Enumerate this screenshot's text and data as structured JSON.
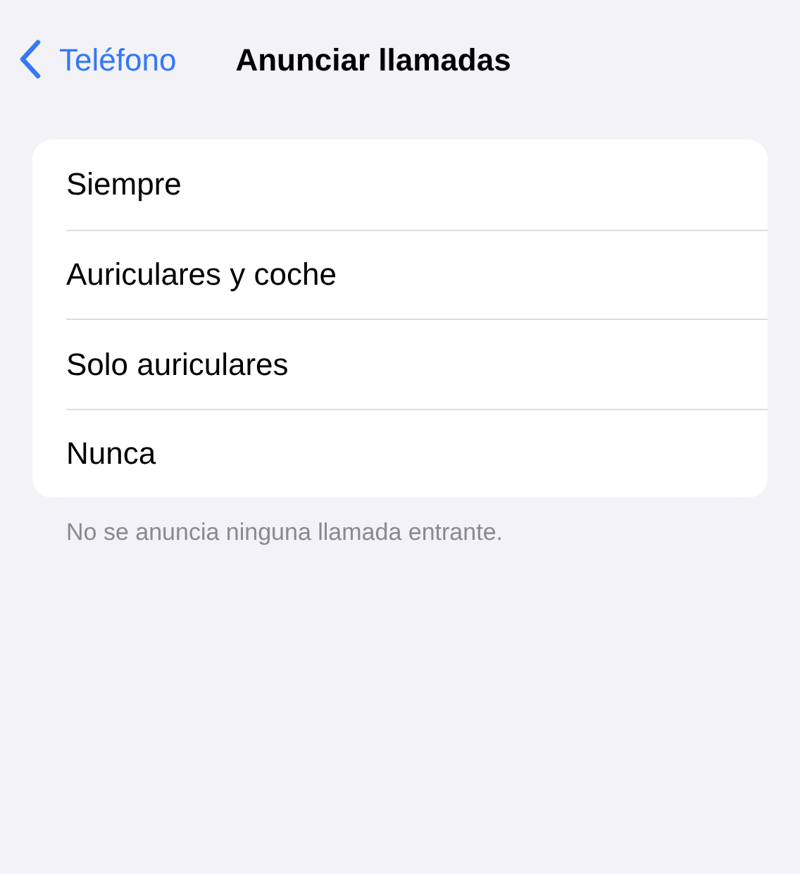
{
  "nav": {
    "back_label": "Teléfono",
    "title": "Anunciar llamadas"
  },
  "options": [
    {
      "label": "Siempre"
    },
    {
      "label": "Auriculares y coche"
    },
    {
      "label": "Solo auriculares"
    },
    {
      "label": "Nunca"
    }
  ],
  "footer": "No se anuncia ninguna llamada entrante."
}
